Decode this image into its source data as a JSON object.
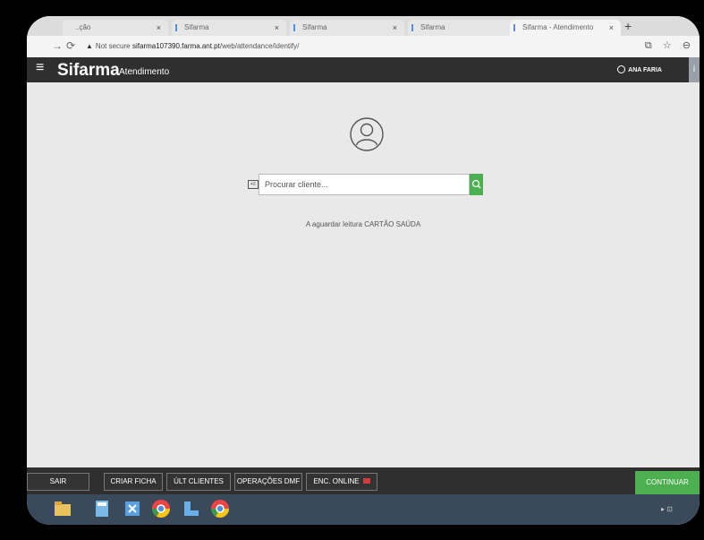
{
  "browser": {
    "tabs": [
      {
        "label": "..ção"
      },
      {
        "label": "Sifarma"
      },
      {
        "label": "Sifarma"
      },
      {
        "label": "Sifarma"
      },
      {
        "label": "Sifarma - Atendimento"
      }
    ],
    "tab_close": "×",
    "new_tab": "+",
    "security_label": "Not secure",
    "url_host": "sifarma107390.farma.ant.pt",
    "url_path": "/web/attendance/identify/"
  },
  "header": {
    "brand": "Sifarma",
    "module": "Atendimento",
    "user": "ANA FARIA"
  },
  "search": {
    "placeholder": "Procurar cliente...",
    "value": ""
  },
  "status_text": "A aguardar leitura CARTÃO SAÚDA",
  "toolbar": {
    "buttons": [
      "SAIR",
      "CRIAR FICHA",
      "ÚLT CLIENTES",
      "OPERAÇÕES DMF",
      "ENC. ONLINE"
    ],
    "continue": "CONTINUAR"
  },
  "colors": {
    "accent_green": "#4caf50",
    "header_dark": "#2f2f2f",
    "badge_red": "#d23c3c"
  },
  "icons": [
    "back-icon",
    "forward-icon",
    "reload-icon",
    "warning-icon",
    "star-icon",
    "profile-icon",
    "menu-icon",
    "user-icon",
    "info-icon",
    "avatar-icon",
    "id-card-icon",
    "search-icon"
  ]
}
